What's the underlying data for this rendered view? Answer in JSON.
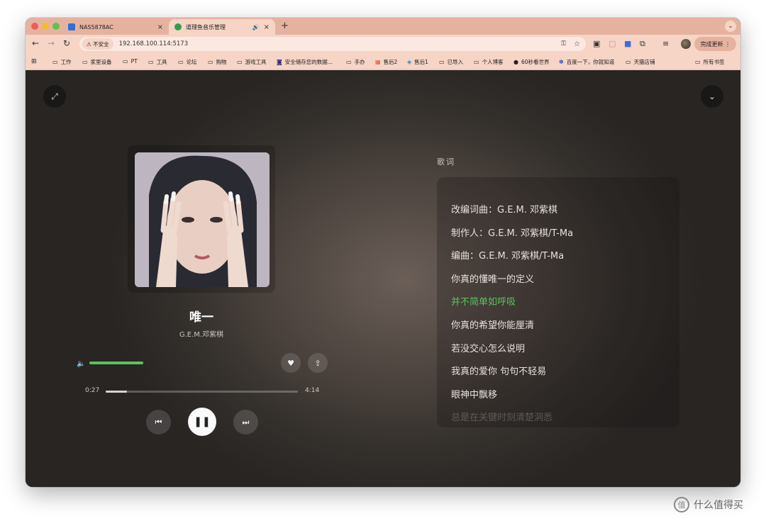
{
  "browser": {
    "tabs": [
      {
        "title": "NAS5878AC",
        "close": "×"
      },
      {
        "title": "道理鱼音乐管理",
        "audio": "🔊",
        "close": "×"
      }
    ],
    "new_tab": "+",
    "tab_menu": "⌄",
    "nav": {
      "back": "←",
      "forward": "→",
      "reload": "↻"
    },
    "security_chip": "⚠ 不安全",
    "url": "192.168.100.114:5173",
    "update_button": "完成更新 ⋮",
    "bookmarks": [
      {
        "label": "工作",
        "icon": "folder-icon"
      },
      {
        "label": "家里设备",
        "icon": "folder-icon"
      },
      {
        "label": "PT",
        "icon": "folder-icon"
      },
      {
        "label": "工具",
        "icon": "folder-icon"
      },
      {
        "label": "论坛",
        "icon": "folder-icon"
      },
      {
        "label": "购物",
        "icon": "folder-icon"
      },
      {
        "label": "游戏工具",
        "icon": "folder-icon"
      },
      {
        "label": "安全储存您的数据...",
        "icon": "site-icon"
      },
      {
        "label": "手办",
        "icon": "folder-icon"
      },
      {
        "label": "售后2",
        "icon": "site-icon"
      },
      {
        "label": "售后1",
        "icon": "site-icon"
      },
      {
        "label": "已导入",
        "icon": "folder-icon"
      },
      {
        "label": "个人博客",
        "icon": "folder-icon"
      },
      {
        "label": "60秒看世界",
        "icon": "site-icon"
      },
      {
        "label": "百度一下，你就知道",
        "icon": "site-icon"
      },
      {
        "label": "天猫店铺",
        "icon": "folder-icon"
      }
    ],
    "all_bookmarks": "所有书签"
  },
  "player": {
    "song_title": "唯一",
    "artist": "G.E.M.邓紫棋",
    "current_time": "0:27",
    "total_time": "4:14",
    "progress": 0.11,
    "volume": 0.7,
    "accent_color": "#59c35a"
  },
  "lyrics": {
    "heading": "歌词",
    "lines": [
      "改编词曲：G.E.M. 邓紫棋",
      "制作人：G.E.M. 邓紫棋/T-Ma",
      "编曲：G.E.M. 邓紫棋/T-Ma",
      "你真的懂唯一的定义",
      "并不简单如呼吸",
      "你真的希望你能厘清",
      "若没交心怎么说明",
      "我真的爱你 句句不轻易",
      "眼神中飘移",
      "总是在关键时刻清楚洞悉"
    ],
    "current_index": 4
  },
  "watermark": "什么值得买"
}
